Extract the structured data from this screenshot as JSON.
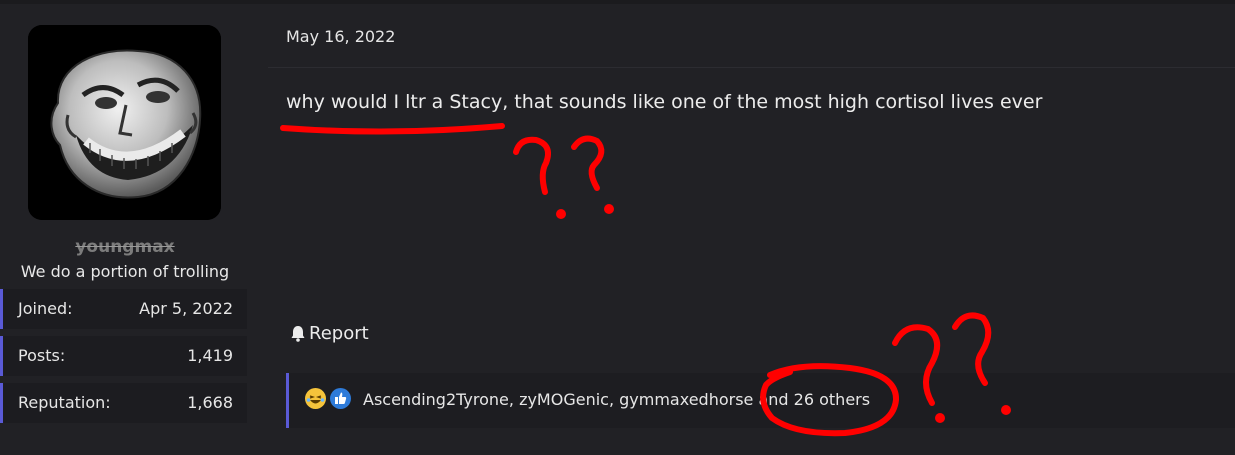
{
  "user": {
    "username": "youngmax",
    "title": "We do a portion of trolling",
    "avatar_icon": "troll-face-avatar",
    "stats": [
      {
        "label": "Joined:",
        "value": "Apr 5, 2022"
      },
      {
        "label": "Posts:",
        "value": "1,419"
      },
      {
        "label": "Reputation:",
        "value": "1,668"
      }
    ]
  },
  "post": {
    "date": "May 16, 2022",
    "body": "why would I ltr a Stacy, that sounds like one of the most high cortisol lives ever",
    "report_label": "Report",
    "report_icon": "bell-icon"
  },
  "reactions": {
    "icons": [
      "laugh-emoji-icon",
      "like-icon"
    ],
    "text": "Ascending2Tyrone, zyMOGenic, gymmaxedhorse and 26 others"
  },
  "colors": {
    "background": "#1b1b1e",
    "panel": "#212125",
    "accent_border": "#5a5ad6",
    "annotation_red": "#ff0000"
  }
}
